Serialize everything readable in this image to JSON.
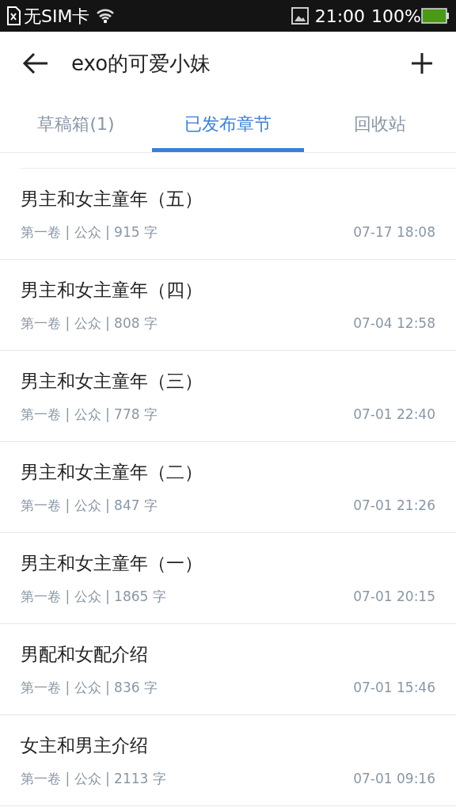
{
  "status_bar": {
    "carrier": "无SIM卡",
    "time": "21:00",
    "battery": "100%"
  },
  "header": {
    "title": "exo的可爱小妹"
  },
  "tabs": [
    {
      "label": "草稿箱(1)",
      "selected": false
    },
    {
      "label": "已发布章节",
      "selected": true
    },
    {
      "label": "回收站",
      "selected": false
    }
  ],
  "chapters": [
    {
      "title": "男主和女主童年（五）",
      "meta": "第一卷 | 公众 | 915 字",
      "date": "07-17 18:08"
    },
    {
      "title": "男主和女主童年（四）",
      "meta": "第一卷 | 公众 | 808 字",
      "date": "07-04 12:58"
    },
    {
      "title": "男主和女主童年（三）",
      "meta": "第一卷 | 公众 | 778 字",
      "date": "07-01 22:40"
    },
    {
      "title": "男主和女主童年（二）",
      "meta": "第一卷 | 公众 | 847 字",
      "date": "07-01 21:26"
    },
    {
      "title": "男主和女主童年（一）",
      "meta": "第一卷 | 公众 | 1865 字",
      "date": "07-01 20:15"
    },
    {
      "title": "男配和女配介绍",
      "meta": "第一卷 | 公众 | 836 字",
      "date": "07-01 15:46"
    },
    {
      "title": "女主和男主介绍",
      "meta": "第一卷 | 公众 | 2113 字",
      "date": "07-01 09:16"
    }
  ]
}
